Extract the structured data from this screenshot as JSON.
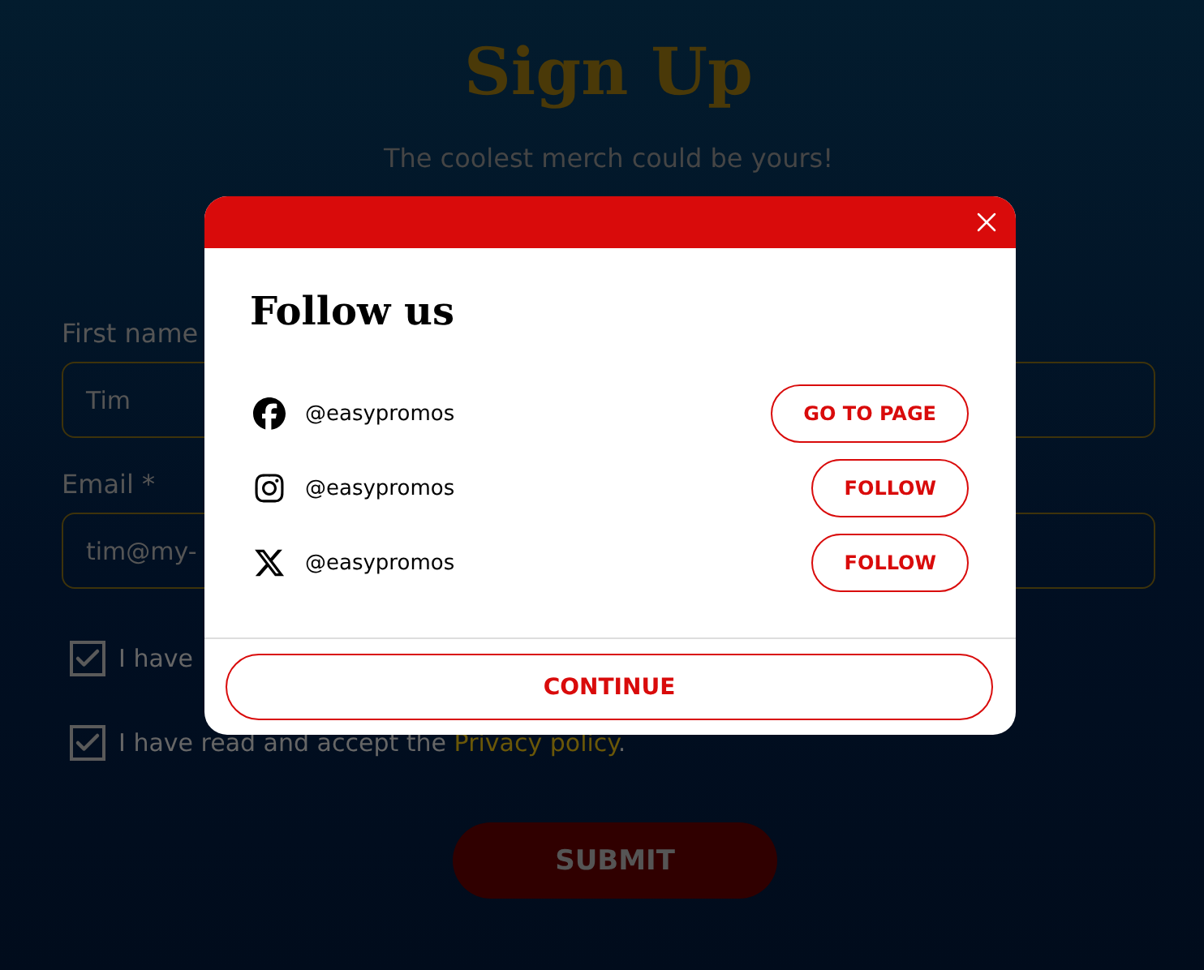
{
  "form": {
    "title": "Sign Up",
    "subtitle": "The coolest merch could be yours!",
    "fields": [
      {
        "label": "First name",
        "value": "Tim"
      },
      {
        "label": "Email *",
        "value": "tim@my-"
      }
    ],
    "checkboxes": [
      {
        "text": "I have",
        "checked": true
      },
      {
        "text": "I have read and accept the",
        "link": "Privacy policy",
        "after": ".",
        "checked": true
      }
    ],
    "submit": "SUBMIT"
  },
  "dialog": {
    "title": "Follow us",
    "socials": [
      {
        "kind": "facebook",
        "handle": "@easypromos",
        "action": "GO TO PAGE"
      },
      {
        "kind": "instagram",
        "handle": "@easypromos",
        "action": "FOLLOW"
      },
      {
        "kind": "x",
        "handle": "@easypromos",
        "action": "FOLLOW"
      }
    ],
    "continue": "CONTINUE"
  }
}
